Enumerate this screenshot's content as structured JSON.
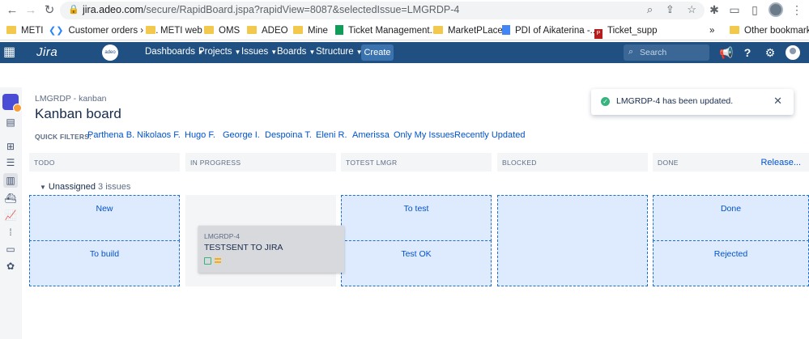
{
  "browser": {
    "url_host": "jira.adeo.com",
    "url_path": "/secure/RapidBoard.jspa?rapidView=8087&selectedIssue=LMGRDP-4",
    "bookmarks": [
      {
        "label": "METI",
        "icon": "folder-icon"
      },
      {
        "label": "Customer orders › T...",
        "icon": "jira-icon"
      },
      {
        "label": "METI web",
        "icon": "folder-icon"
      },
      {
        "label": "OMS",
        "icon": "folder-icon"
      },
      {
        "label": "ADEO",
        "icon": "folder-icon"
      },
      {
        "label": "Mine",
        "icon": "folder-icon"
      },
      {
        "label": "Ticket Management...",
        "icon": "sheets-icon"
      },
      {
        "label": "MarketPLace",
        "icon": "folder-icon"
      },
      {
        "label": "PDI of Aikaterina -...",
        "icon": "docs-icon"
      },
      {
        "label": "Ticket_supp",
        "icon": "pdf-icon"
      }
    ],
    "more_bookmarks": "»",
    "other_bookmarks": "Other bookmarks"
  },
  "jira_header": {
    "logo": "Jira",
    "adeo_logo": "adeo",
    "menus": [
      "Dashboards",
      "Projects",
      "Issues",
      "Boards",
      "Structure"
    ],
    "create_label": "Create",
    "search_placeholder": "Search"
  },
  "board": {
    "breadcrumb": "LMGRDP - kanban",
    "title": "Kanban board",
    "quick_filters_label": "QUICK FILTERS:",
    "quick_filters": [
      "Parthena B.",
      "Nikolaos F.",
      "Hugo F.",
      "George I.",
      "Despoina T.",
      "Eleni R.",
      "Amerissa",
      "Only My Issues",
      "Recently Updated"
    ],
    "columns": [
      "TODO",
      "IN PROGRESS",
      "TOTEST LMGR",
      "BLOCKED",
      "DONE"
    ],
    "release_label": "Release...",
    "swimlane": {
      "label": "Unassigned",
      "count": "3 issues"
    },
    "drop_zones": {
      "todo": [
        "New",
        "To build"
      ],
      "totest": [
        "To test",
        "Test OK"
      ],
      "done": [
        "Done",
        "Rejected"
      ]
    },
    "card": {
      "key": "LMGRDP-4",
      "summary": "TESTSENT TO JIRA"
    }
  },
  "flag": {
    "message": "LMGRDP-4 has been updated."
  }
}
